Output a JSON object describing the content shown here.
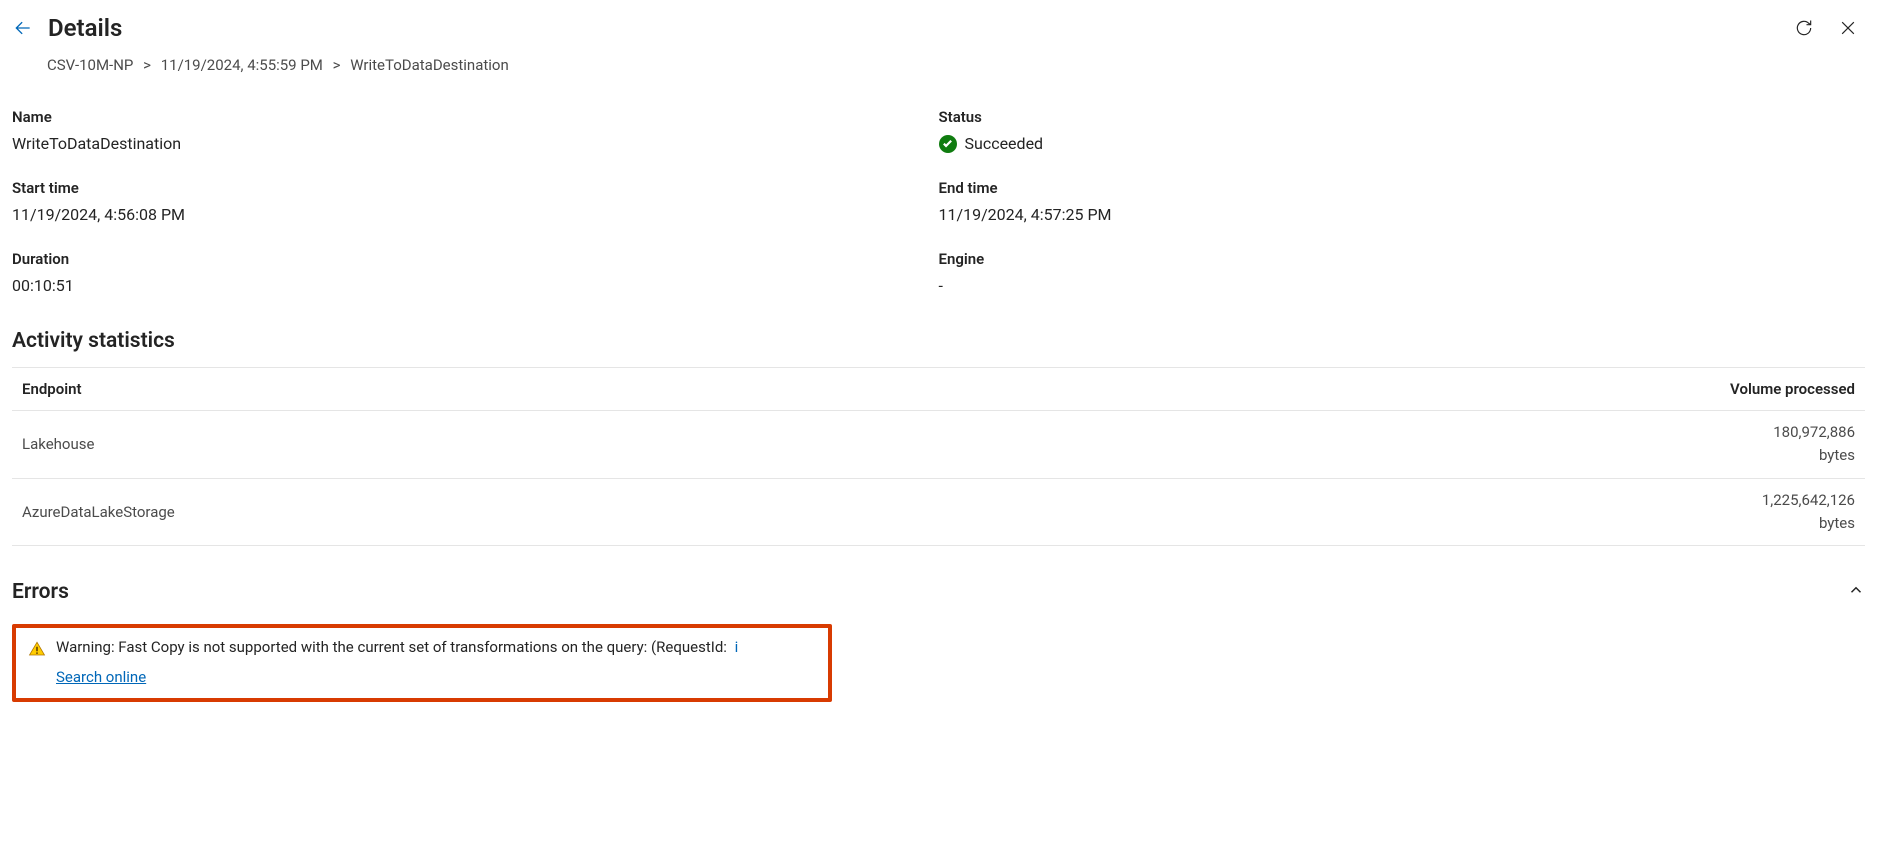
{
  "header": {
    "title": "Details"
  },
  "breadcrumb": {
    "seg0": "CSV-10M-NP",
    "seg1": "11/19/2024, 4:55:59 PM",
    "seg2": "WriteToDataDestination",
    "sep": ">"
  },
  "labels": {
    "name": "Name",
    "status": "Status",
    "start_time": "Start time",
    "end_time": "End time",
    "duration": "Duration",
    "engine": "Engine"
  },
  "values": {
    "name": "WriteToDataDestination",
    "status": "Succeeded",
    "start_time": "11/19/2024, 4:56:08 PM",
    "end_time": "11/19/2024, 4:57:25 PM",
    "duration": "00:10:51",
    "engine": "-"
  },
  "activity": {
    "heading": "Activity statistics",
    "columns": {
      "endpoint": "Endpoint",
      "volume": "Volume processed"
    },
    "rows": [
      {
        "endpoint": "Lakehouse",
        "volume_num": "180,972,886",
        "volume_unit": "bytes"
      },
      {
        "endpoint": "AzureDataLakeStorage",
        "volume_num": "1,225,642,126",
        "volume_unit": "bytes"
      }
    ]
  },
  "errors": {
    "heading": "Errors",
    "warning_text": "Warning: Fast Copy is not supported with the current set of transformations on the query: (RequestId:",
    "request_tail": "i",
    "search_link": "Search online"
  }
}
